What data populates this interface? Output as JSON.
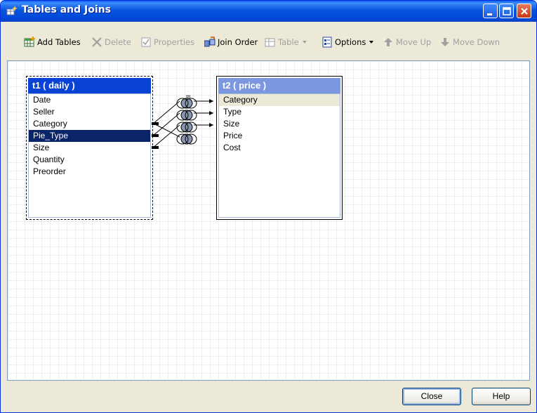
{
  "window": {
    "title": "Tables and Joins"
  },
  "toolbar": {
    "add_tables": "Add Tables",
    "delete": "Delete",
    "properties": "Properties",
    "join_order": "Join Order",
    "table": "Table",
    "options": "Options",
    "move_up": "Move Up",
    "move_down": "Move Down"
  },
  "tables": {
    "t1": {
      "title": "t1 ( daily )",
      "columns": [
        "Date",
        "Seller",
        "Category",
        "Pie_Type",
        "Size",
        "Quantity",
        "Preorder"
      ],
      "selected": "Pie_Type"
    },
    "t2": {
      "title": "t2 ( price )",
      "columns": [
        "Category",
        "Type",
        "Size",
        "Price",
        "Cost"
      ],
      "highlighted": "Category"
    }
  },
  "join": {
    "operator": "=",
    "count": 4
  },
  "buttons": {
    "close": "Close",
    "help": "Help"
  },
  "colors": {
    "title_bar": "#0054E3",
    "selected_header": "#0A42D6",
    "inactive_header": "#7B97E0",
    "selection": "#0A246A",
    "row_highlight": "#ECE9D8"
  }
}
